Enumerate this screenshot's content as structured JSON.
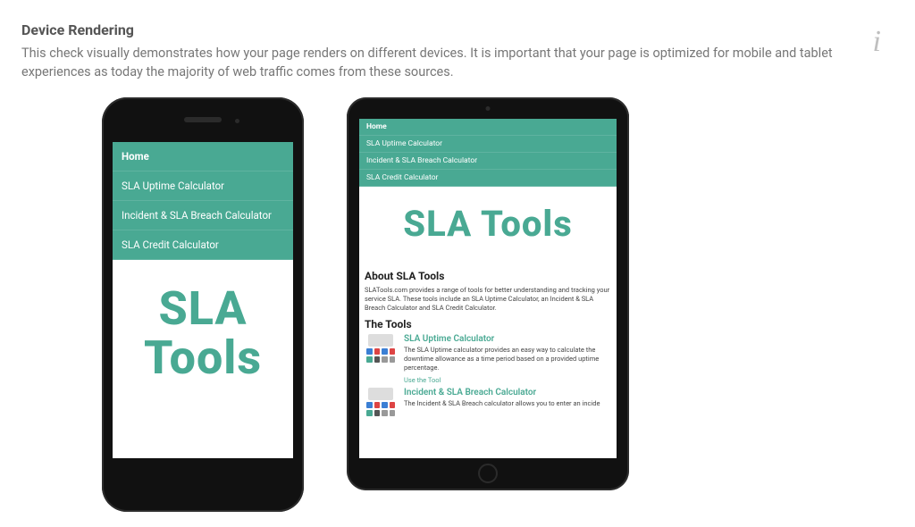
{
  "section": {
    "title": "Device Rendering",
    "description": "This check visually demonstrates how your page renders on different devices. It is important that your page is optimized for mobile and tablet experiences as today the majority of web traffic comes from these sources."
  },
  "info_icon_glyph": "i",
  "rendered_page": {
    "nav_items": [
      "Home",
      "SLA Uptime Calculator",
      "Incident & SLA Breach Calculator",
      "SLA Credit Calculator"
    ],
    "hero": "SLA Tools",
    "about_heading": "About SLA Tools",
    "about_text": "SLATools.com provides a range of tools for better understanding and tracking your service SLA. These tools include an SLA Uptime Calculator, an Incident & SLA Breach Calculator and SLA Credit Calculator.",
    "tools_heading": "The Tools",
    "tools": [
      {
        "title": "SLA Uptime Calculator",
        "desc": "The SLA Uptime calculator provides an easy way to calculate the downtime allowance as a time period based on a provided uptime percentage.",
        "link_label": "Use the Tool"
      },
      {
        "title": "Incident & SLA Breach Calculator",
        "desc": "The Incident & SLA Breach calculator allows you to enter an incide"
      }
    ]
  }
}
